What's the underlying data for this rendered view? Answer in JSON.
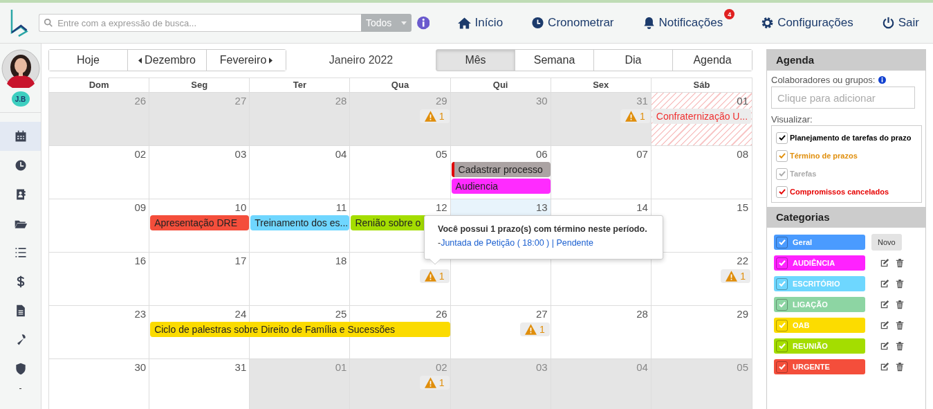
{
  "topbar": {
    "search": {
      "placeholder": "Entre com a expressão de busca...",
      "scope": "Todos"
    },
    "nav": [
      {
        "label": "Início"
      },
      {
        "label": "Cronometrar"
      },
      {
        "label": "Notificações",
        "badge": "4"
      },
      {
        "label": "Configurações"
      },
      {
        "label": "Sair"
      }
    ]
  },
  "sidebar": {
    "user_initials": "J.B",
    "items": [
      {
        "selected": true
      },
      {
        "selected": false
      },
      {
        "selected": false
      },
      {
        "selected": false
      },
      {
        "selected": false
      },
      {
        "selected": false
      },
      {
        "selected": false
      },
      {
        "selected": false
      },
      {
        "selected": false
      }
    ],
    "footer": "-"
  },
  "toolbar": {
    "nav_buttons": [
      "Hoje",
      "Dezembro",
      "Fevereiro"
    ],
    "title": "Janeiro 2022",
    "views": [
      {
        "label": "Mês",
        "selected": true
      },
      {
        "label": "Semana",
        "selected": false
      },
      {
        "label": "Dia",
        "selected": false
      },
      {
        "label": "Agenda",
        "selected": false
      }
    ]
  },
  "calendar": {
    "weekdays": [
      "Dom",
      "Seg",
      "Ter",
      "Qua",
      "Qui",
      "Sex",
      "Sáb"
    ],
    "weeks": [
      {
        "days": [
          {
            "day": "26",
            "kind": "other"
          },
          {
            "day": "27",
            "kind": "other"
          },
          {
            "day": "28",
            "kind": "other"
          },
          {
            "day": "29",
            "kind": "other",
            "items": [
              {
                "kind": "deadline",
                "count": "1"
              }
            ]
          },
          {
            "day": "30",
            "kind": "other"
          },
          {
            "day": "31",
            "kind": "other",
            "items": [
              {
                "kind": "deadline",
                "count": "1"
              }
            ]
          },
          {
            "day": "01",
            "kind": "cancelled",
            "items": [
              {
                "kind": "cancelled",
                "label": "Confraternização U..."
              }
            ]
          }
        ]
      },
      {
        "days": [
          {
            "day": "02",
            "kind": "current"
          },
          {
            "day": "03",
            "kind": "current"
          },
          {
            "day": "04",
            "kind": "current"
          },
          {
            "day": "05",
            "kind": "current"
          },
          {
            "day": "06",
            "kind": "current",
            "items": [
              {
                "kind": "task",
                "label": "Cadastrar processo",
                "color": "#aba3a3"
              },
              {
                "kind": "event",
                "label": "Audiencia",
                "color": "#ff2bff"
              }
            ]
          },
          {
            "day": "07",
            "kind": "current"
          },
          {
            "day": "08",
            "kind": "current"
          }
        ]
      },
      {
        "days": [
          {
            "day": "09",
            "kind": "current"
          },
          {
            "day": "10",
            "kind": "current",
            "items": [
              {
                "kind": "event",
                "label": "Apresentação DRE",
                "color": "#f44e3b"
              }
            ]
          },
          {
            "day": "11",
            "kind": "current",
            "items": [
              {
                "kind": "event",
                "label": "Treinamento dos es...",
                "color": "#6fd6ff"
              }
            ]
          },
          {
            "day": "12",
            "kind": "current",
            "items": [
              {
                "kind": "event",
                "label": "Renião sobre o",
                "color": "#a4dd00"
              }
            ]
          },
          {
            "day": "13",
            "kind": "today"
          },
          {
            "day": "14",
            "kind": "current"
          },
          {
            "day": "15",
            "kind": "current"
          }
        ]
      },
      {
        "days": [
          {
            "day": "16",
            "kind": "current"
          },
          {
            "day": "17",
            "kind": "current"
          },
          {
            "day": "18",
            "kind": "current"
          },
          {
            "kind": "current",
            "items": [
              {
                "kind": "deadline",
                "count": "1"
              }
            ]
          },
          {
            "kind": "current"
          },
          {
            "kind": "current"
          },
          {
            "day": "22",
            "kind": "current",
            "items": [
              {
                "kind": "deadline",
                "count": "1"
              }
            ]
          }
        ]
      },
      {
        "days": [
          {
            "day": "23",
            "kind": "current"
          },
          {
            "day": "24",
            "kind": "current",
            "items": [
              {
                "kind": "event",
                "label": "Ciclo de palestras sobre Direito de Família e Sucessões",
                "color": "#fbdb00"
              }
            ]
          },
          {
            "day": "25",
            "kind": "current",
            "items": [
              {
                "kind": "continued"
              }
            ]
          },
          {
            "day": "26",
            "kind": "current",
            "items": [
              {
                "kind": "continued"
              }
            ]
          },
          {
            "day": "27",
            "kind": "current",
            "items": [
              {
                "kind": "deadline",
                "count": "1"
              }
            ]
          },
          {
            "day": "28",
            "kind": "current"
          },
          {
            "day": "29",
            "kind": "current"
          }
        ]
      },
      {
        "days": [
          {
            "day": "30",
            "kind": "current"
          },
          {
            "day": "31",
            "kind": "current"
          },
          {
            "day": "01",
            "kind": "other"
          },
          {
            "day": "02",
            "kind": "other",
            "items": [
              {
                "kind": "deadline",
                "count": "1"
              }
            ]
          },
          {
            "day": "03",
            "kind": "other"
          },
          {
            "day": "04",
            "kind": "other"
          },
          {
            "day": "05",
            "kind": "other"
          }
        ]
      }
    ],
    "tooltip": {
      "message": "Você possui 1 prazo(s) com término neste período.",
      "link_prefix": "-",
      "link": "Juntada de Petição ( 18:00 ) | Pendente"
    }
  },
  "agenda": {
    "title": "Agenda",
    "collaborators_label": "Colaboradores ou grupos:",
    "collaborators": {
      "placeholder": "Clique para adicionar"
    },
    "view_label": "Visualizar:",
    "filters": [
      {
        "label": "Planejamento de tarefas do prazo",
        "checked": true,
        "color": "#000000"
      },
      {
        "label": "Término de prazos",
        "checked": true,
        "color": "#e08e0b"
      },
      {
        "label": "Tarefas",
        "checked": true,
        "color": "#aaaaaa"
      },
      {
        "label": "Compromissos cancelados",
        "checked": true,
        "color": "#e60000"
      }
    ]
  },
  "categories": {
    "title": "Categorias",
    "new_button": "Novo",
    "items": [
      {
        "label": "Geral",
        "checked": true,
        "color": "#4a9bff",
        "editable": false
      },
      {
        "label": "AUDIÊNCIA",
        "checked": true,
        "color": "#ff22ff",
        "editable": true
      },
      {
        "label": "ESCRITÓRIO",
        "checked": true,
        "color": "#6ed7ff",
        "editable": true
      },
      {
        "label": "LIGAÇÃO",
        "checked": true,
        "color": "#8dd5a3",
        "editable": true
      },
      {
        "label": "OAB",
        "checked": true,
        "color": "#fcdc00",
        "editable": true
      },
      {
        "label": "REUNIÃO",
        "checked": true,
        "color": "#a4dd00",
        "editable": true
      },
      {
        "label": "URGENTE",
        "checked": true,
        "color": "#f44e3b",
        "editable": true
      }
    ]
  }
}
